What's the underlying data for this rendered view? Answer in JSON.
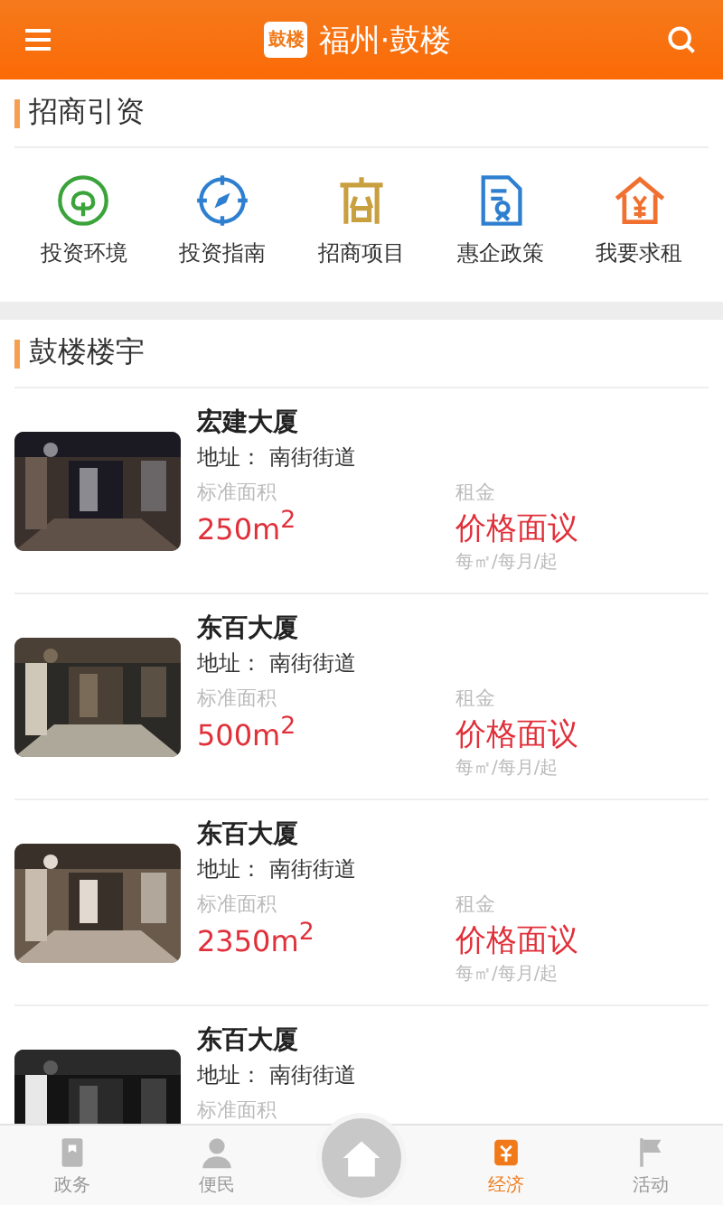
{
  "header": {
    "title": "福州·鼓楼",
    "logo_text": "鼓楼"
  },
  "invest_section": {
    "title": "招商引资",
    "items": [
      {
        "label": "投资环境"
      },
      {
        "label": "投资指南"
      },
      {
        "label": "招商项目"
      },
      {
        "label": "惠企政策"
      },
      {
        "label": "我要求租"
      }
    ]
  },
  "buildings_section": {
    "title": "鼓楼楼宇",
    "cards": [
      {
        "name": "宏建大厦",
        "address_label": "地址：",
        "address": "南街街道",
        "area_label": "标准面积",
        "area": "250m$^{2}$",
        "rent_label": "租金",
        "rent": "价格面议",
        "rent_unit": "每㎡/每月/起"
      },
      {
        "name": "东百大厦",
        "address_label": "地址：",
        "address": "南街街道",
        "area_label": "标准面积",
        "area": "500m$^{2}$",
        "rent_label": "租金",
        "rent": "价格面议",
        "rent_unit": "每㎡/每月/起"
      },
      {
        "name": "东百大厦",
        "address_label": "地址：",
        "address": "南街街道",
        "area_label": "标准面积",
        "area": "2350m$^{2}$",
        "rent_label": "租金",
        "rent": "价格面议",
        "rent_unit": "每㎡/每月/起"
      },
      {
        "name": "东百大厦",
        "address_label": "地址：",
        "address": "南街街道",
        "area_label": "标准面积"
      }
    ]
  },
  "bottom_nav": [
    {
      "label": "政务",
      "kind": "tab",
      "selected": false
    },
    {
      "label": "便民",
      "kind": "tab",
      "selected": false
    },
    {
      "kind": "center",
      "selected": false
    },
    {
      "label": "经济",
      "kind": "tab",
      "selected": true
    },
    {
      "label": "活动",
      "kind": "tab",
      "selected": false
    }
  ]
}
